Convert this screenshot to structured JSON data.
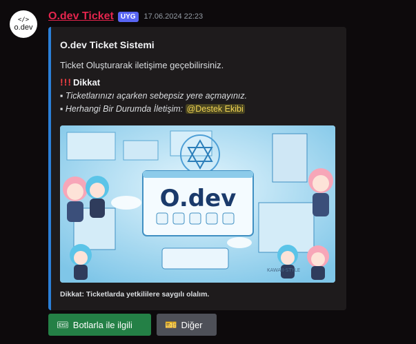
{
  "message": {
    "author": "O.dev Ticket",
    "badge": "UYG",
    "timestamp": "17.06.2024 22:23",
    "avatar_text": "o.dev",
    "avatar_glyph": "</>"
  },
  "embed": {
    "accent_color": "#2b7fd8",
    "title": "O.dev Ticket Sistemi",
    "description": "Ticket Oluşturarak iletişime geçebilirsiniz.",
    "warning_marks": "!!!",
    "warning_title": "Dikkat",
    "bullet_1": "▪ Ticketlarınızı açarken sebepsiz yere açmayınız.",
    "bullet_2": "▪ Herhangi Bir Durumda İletişim:",
    "mention": "@Destek Ekibi",
    "image": {
      "logo_text": "O.dev",
      "watermark": "KAWAII-STYLE"
    },
    "footer": "Dikkat: Ticketlarda yetkililere saygılı olalım."
  },
  "buttons": [
    {
      "label": "Botlarla ile ilgili",
      "icon": "ticket-icon",
      "color": "#248046"
    },
    {
      "label": "Diğer",
      "icon": "ticket-gray-icon",
      "color": "#4e5058"
    }
  ]
}
